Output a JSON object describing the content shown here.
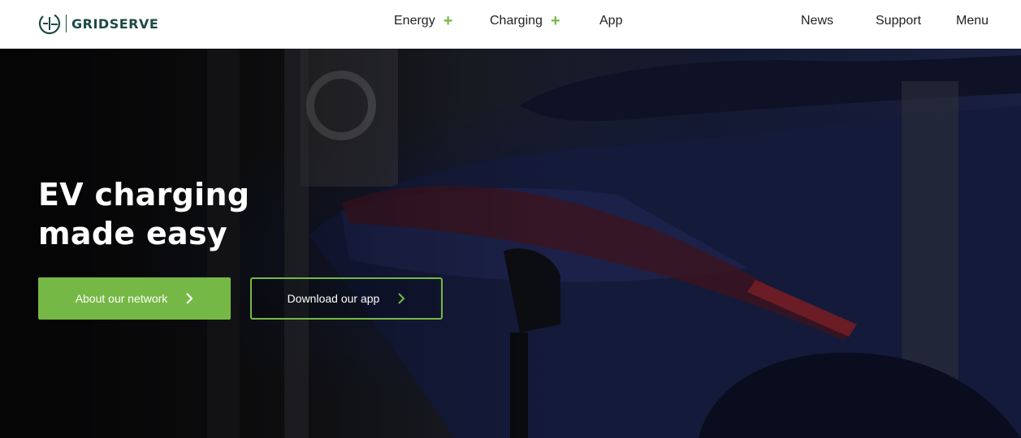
{
  "header": {
    "logo_text": "GRIDSERVE",
    "nav": {
      "energy": "Energy",
      "charging": "Charging",
      "app": "App",
      "news": "News",
      "support": "Support",
      "menu": "Menu"
    },
    "expand_symbol": "+"
  },
  "hero": {
    "title": "EV charging made easy",
    "buttons": {
      "network": "About our network",
      "app": "Download our app"
    }
  },
  "colors": {
    "brand_green": "#76b845",
    "brand_teal": "#1d4a45",
    "header_bg": "#ffffff",
    "hero_text": "#ffffff"
  },
  "icons": [
    "gridserve-logo-icon",
    "plus-icon",
    "chevron-right-icon"
  ]
}
